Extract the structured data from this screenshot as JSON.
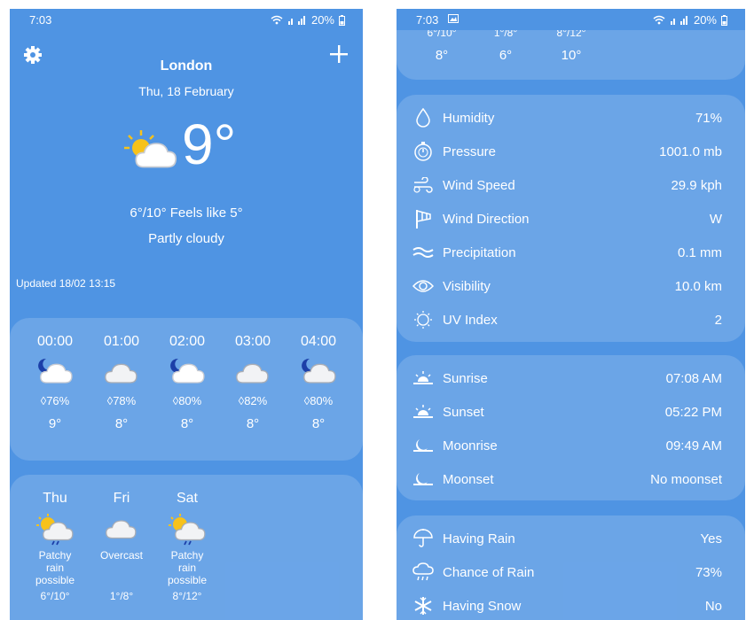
{
  "left_screen": {
    "status": {
      "time": "7:03",
      "battery": "20%"
    },
    "city": "London",
    "date": "Thu, 18 February",
    "current_temp": "9°",
    "current_icon": "partly-cloudy-icon",
    "minmax_feels": "6°/10° Feels like 5°",
    "condition": "Partly cloudy",
    "updated": "Updated 18/02 13:15",
    "hourly": [
      {
        "time": "00:00",
        "icon": "moon-cloud-icon",
        "humidity": "76%",
        "temp": "9°"
      },
      {
        "time": "01:00",
        "icon": "cloud-icon",
        "humidity": "78%",
        "temp": "8°"
      },
      {
        "time": "02:00",
        "icon": "moon-cloud-icon",
        "humidity": "80%",
        "temp": "8°"
      },
      {
        "time": "03:00",
        "icon": "cloud-icon",
        "humidity": "82%",
        "temp": "8°"
      },
      {
        "time": "04:00",
        "icon": "moon-cloud-icon",
        "humidity": "80%",
        "temp": "8°"
      }
    ],
    "daily": [
      {
        "day": "Thu",
        "icon": "sun-cloud-rain-icon",
        "cond1": "Patchy",
        "cond2": "rain",
        "cond3": "possible",
        "range": "6°/10°"
      },
      {
        "day": "Fri",
        "icon": "cloud-icon",
        "cond1": "Overcast",
        "cond2": "",
        "cond3": "",
        "range": "1°/8°"
      },
      {
        "day": "Sat",
        "icon": "sun-cloud-rain-icon",
        "cond1": "Patchy",
        "cond2": "rain",
        "cond3": "possible",
        "range": "8°/12°"
      }
    ]
  },
  "right_screen": {
    "status": {
      "time": "7:03",
      "battery": "20%"
    },
    "daily_partial": [
      {
        "range": "6°/10°",
        "temp": "8°"
      },
      {
        "range": "1°/8°",
        "temp": "6°"
      },
      {
        "range": "8°/12°",
        "temp": "10°"
      }
    ],
    "details": [
      {
        "label": "Humidity",
        "value": "71%",
        "icon": "drop-icon"
      },
      {
        "label": "Pressure",
        "value": "1001.0 mb",
        "icon": "gauge-icon"
      },
      {
        "label": "Wind Speed",
        "value": "29.9 kph",
        "icon": "wind-icon"
      },
      {
        "label": "Wind Direction",
        "value": "W",
        "icon": "windsock-icon"
      },
      {
        "label": "Precipitation",
        "value": "0.1 mm",
        "icon": "waves-icon"
      },
      {
        "label": "Visibility",
        "value": "10.0 km",
        "icon": "eye-icon"
      },
      {
        "label": "UV Index",
        "value": "2",
        "icon": "uv-icon"
      }
    ],
    "astro": [
      {
        "label": "Sunrise",
        "value": "07:08 AM",
        "icon": "sunrise-icon"
      },
      {
        "label": "Sunset",
        "value": "05:22 PM",
        "icon": "sunset-icon"
      },
      {
        "label": "Moonrise",
        "value": "09:49 AM",
        "icon": "moonrise-icon"
      },
      {
        "label": "Moonset",
        "value": "No moonset",
        "icon": "moonset-icon"
      }
    ],
    "rain": [
      {
        "label": "Having Rain",
        "value": "Yes",
        "icon": "umbrella-icon"
      },
      {
        "label": "Chance of Rain",
        "value": "73%",
        "icon": "rain-cloud-icon"
      },
      {
        "label": "Having Snow",
        "value": "No",
        "icon": "snowflake-icon"
      }
    ]
  }
}
